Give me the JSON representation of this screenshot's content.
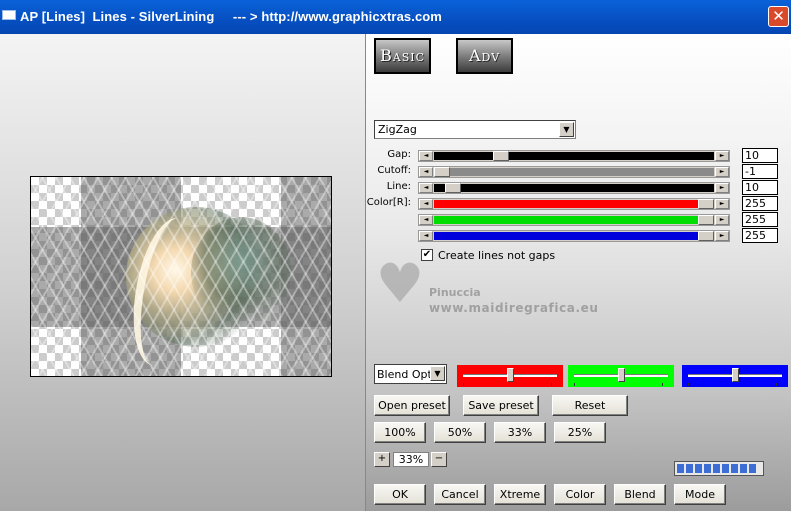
{
  "window": {
    "title": "AP [Lines]  Lines - SilverLining     --- > http://www.graphicxtras.com",
    "close_label": "✕"
  },
  "tabs": {
    "basic": "Basic",
    "adv": "Adv"
  },
  "effect_dropdown": {
    "value": "ZigZag"
  },
  "sliders": [
    {
      "label": "Gap:",
      "value": "10",
      "fill": 0.225,
      "color": "#000000"
    },
    {
      "label": "Cutoff:",
      "value": "-1",
      "fill": 0.0,
      "color": "#8a8a8a"
    },
    {
      "label": "Line:",
      "value": "10",
      "fill": 0.04,
      "color": "#000000"
    },
    {
      "label": "Color[R]:",
      "value": "255",
      "fill": 1.0,
      "color": "#ff0000"
    },
    {
      "label": "",
      "value": "255",
      "fill": 1.0,
      "color": "#00dd00"
    },
    {
      "label": "",
      "value": "255",
      "fill": 1.0,
      "color": "#0000dd"
    }
  ],
  "checkbox": {
    "label": "Create lines not gaps",
    "checked": true,
    "mark": "✔"
  },
  "watermark": {
    "heart": "♥",
    "name": "Pinuccia",
    "url": "www.maidiregrafica.eu"
  },
  "blend": {
    "value": "Blend Options",
    "arrow": "▼"
  },
  "color_sliders": [
    {
      "color": "#ff0000",
      "level": 0.5
    },
    {
      "color": "#00ff00",
      "level": 0.5
    },
    {
      "color": "#0000ff",
      "level": 0.5
    }
  ],
  "preset_buttons": {
    "open": "Open preset",
    "save": "Save preset",
    "reset": "Reset"
  },
  "zoom_buttons": [
    "100%",
    "50%",
    "33%",
    "25%"
  ],
  "zoom": {
    "value": "33%",
    "plus": "+",
    "minus": "−"
  },
  "bottom_buttons": [
    "OK",
    "Cancel",
    "Xtreme",
    "Color",
    "Blend",
    "Mode"
  ],
  "progress": {
    "segments": 9
  },
  "icons": {
    "arrow_left": "◄",
    "arrow_right": "►",
    "dropdown_arrow": "▼"
  }
}
